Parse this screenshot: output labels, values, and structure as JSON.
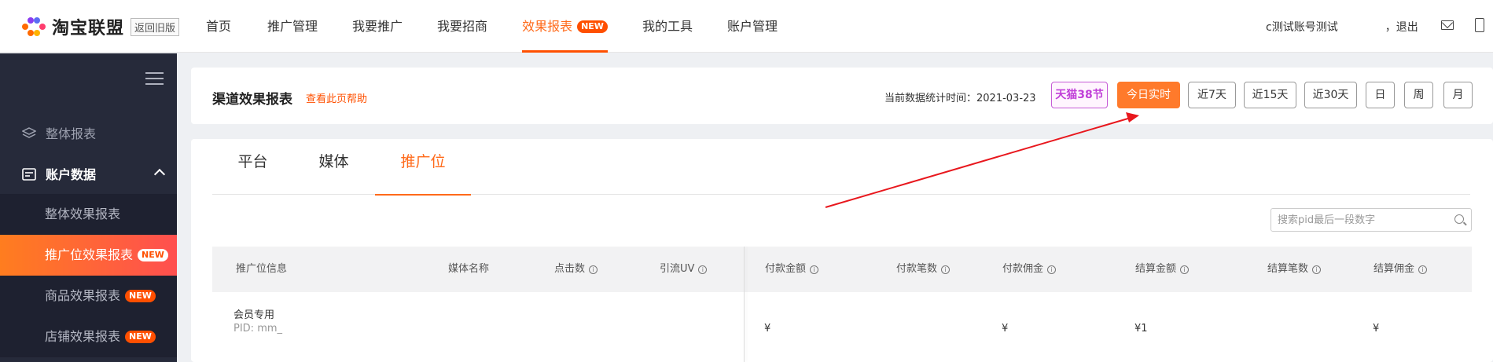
{
  "topbar": {
    "brand": "淘宝联盟",
    "old_version": "返回旧版",
    "nav": [
      {
        "label": "首页"
      },
      {
        "label": "推广管理"
      },
      {
        "label": "我要推广"
      },
      {
        "label": "我要招商"
      },
      {
        "label": "效果报表",
        "badge": "NEW",
        "active": true
      },
      {
        "label": "我的工具"
      },
      {
        "label": "账户管理"
      }
    ],
    "user_name": "c测试账号测试",
    "logout": "，退出"
  },
  "sidebar": {
    "groups": [
      {
        "label": "整体报表",
        "icon": "layers-icon"
      },
      {
        "label": "账户数据",
        "icon": "report-icon",
        "expanded": true
      }
    ],
    "items": [
      {
        "label": "整体效果报表"
      },
      {
        "label": "推广位效果报表",
        "badge": "NEW",
        "active": true
      },
      {
        "label": "商品效果报表",
        "badge": "NEW"
      },
      {
        "label": "店铺效果报表",
        "badge": "NEW"
      }
    ]
  },
  "header": {
    "title": "渠道效果报表",
    "help": "查看此页帮助",
    "stat_time": "当前数据统计时间：2021-03-23",
    "promo": "天猫38节",
    "ranges": [
      {
        "label": "今日实时",
        "active": true
      },
      {
        "label": "近7天"
      },
      {
        "label": "近15天"
      },
      {
        "label": "近30天"
      },
      {
        "label": "日"
      },
      {
        "label": "周"
      },
      {
        "label": "月"
      }
    ]
  },
  "main": {
    "tabs": [
      {
        "label": "平台"
      },
      {
        "label": "媒体"
      },
      {
        "label": "推广位",
        "active": true
      }
    ],
    "search_placeholder": "搜索pid最后一段数字",
    "columns": [
      {
        "label": "推广位信息",
        "info": false
      },
      {
        "label": "媒体名称",
        "info": false
      },
      {
        "label": "点击数",
        "info": true
      },
      {
        "label": "引流UV",
        "info": true
      },
      {
        "label": "付款金额",
        "info": true
      },
      {
        "label": "付款笔数",
        "info": true
      },
      {
        "label": "付款佣金",
        "info": true
      },
      {
        "label": "结算金额",
        "info": true
      },
      {
        "label": "结算笔数",
        "info": true
      },
      {
        "label": "结算佣金",
        "info": true
      }
    ],
    "row": {
      "name": "会员专用",
      "pid": "PID: mm_",
      "pay_amount": "¥",
      "pay_commission": "¥",
      "settle_amount": "¥1",
      "settle_commission": "¥"
    }
  },
  "colors": {
    "accent": "#ff5000",
    "sidebar_bg": "#262a3a",
    "annotation": "#e8171d"
  }
}
